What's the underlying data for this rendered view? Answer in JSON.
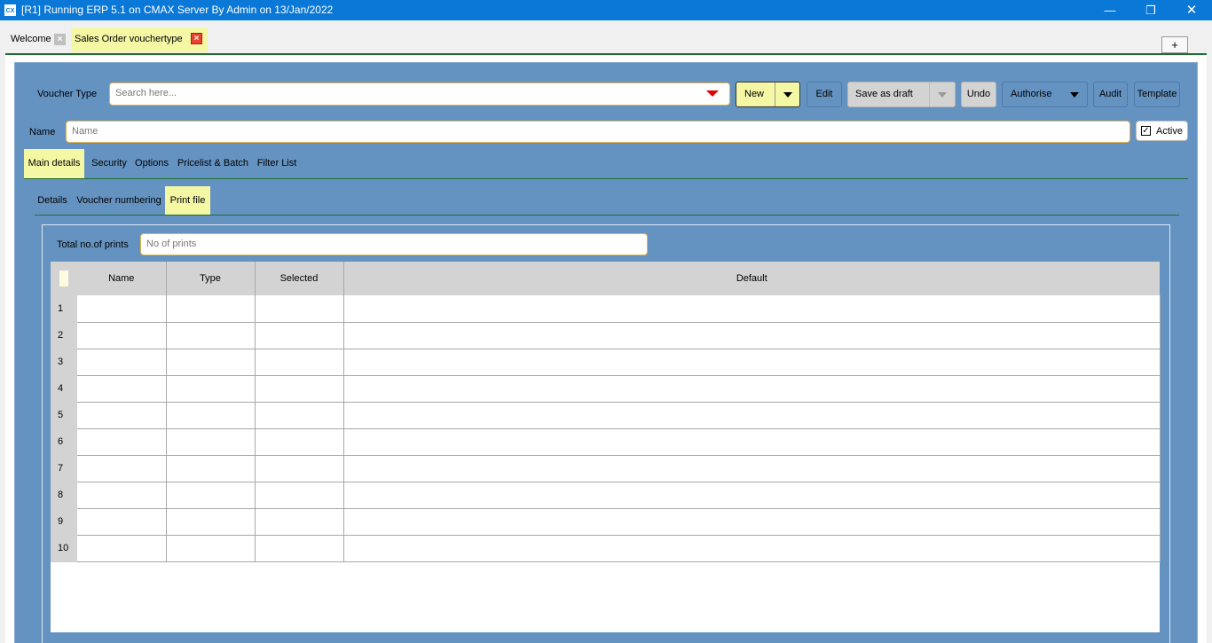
{
  "window": {
    "title": "[R1] Running ERP 5.1 on CMAX Server By Admin on 13/Jan/2022",
    "app_icon_text": "CX",
    "minimize_glyph": "—",
    "maximize_glyph": "❐",
    "close_glyph": "✕"
  },
  "doc_tabs": {
    "welcome": "Welcome",
    "sales": "Sales Order vouchertype",
    "close_glyph": "×",
    "add_glyph": "+"
  },
  "form": {
    "voucher_type_label": "Voucher Type",
    "voucher_search_placeholder": "Search here...",
    "name_label": "Name",
    "name_placeholder": "Name",
    "active_label": "Active",
    "active_checked": true
  },
  "toolbar": {
    "new": "New",
    "edit": "Edit",
    "save_as_draft": "Save as draft",
    "undo": "Undo",
    "authorise": "Authorise",
    "audit": "Audit",
    "template": "Template"
  },
  "main_tabs": [
    "Main details",
    "Security",
    "Options",
    "Pricelist & Batch",
    "Filter List"
  ],
  "sub_tabs": [
    "Details",
    "Voucher numbering",
    "Print file"
  ],
  "print": {
    "total_label": "Total no.of prints",
    "total_placeholder": "No of prints"
  },
  "grid": {
    "columns": [
      "Name",
      "Type",
      "Selected",
      "Default"
    ],
    "rows": [
      "1",
      "2",
      "3",
      "4",
      "5",
      "6",
      "7",
      "8",
      "9",
      "10"
    ]
  },
  "colors": {
    "titlebar": "#0a78d7",
    "panel": "#6493c2",
    "highlight": "#f4f7a4",
    "field_border": "#e5b247",
    "dropdown_arrow": "#e00000"
  }
}
